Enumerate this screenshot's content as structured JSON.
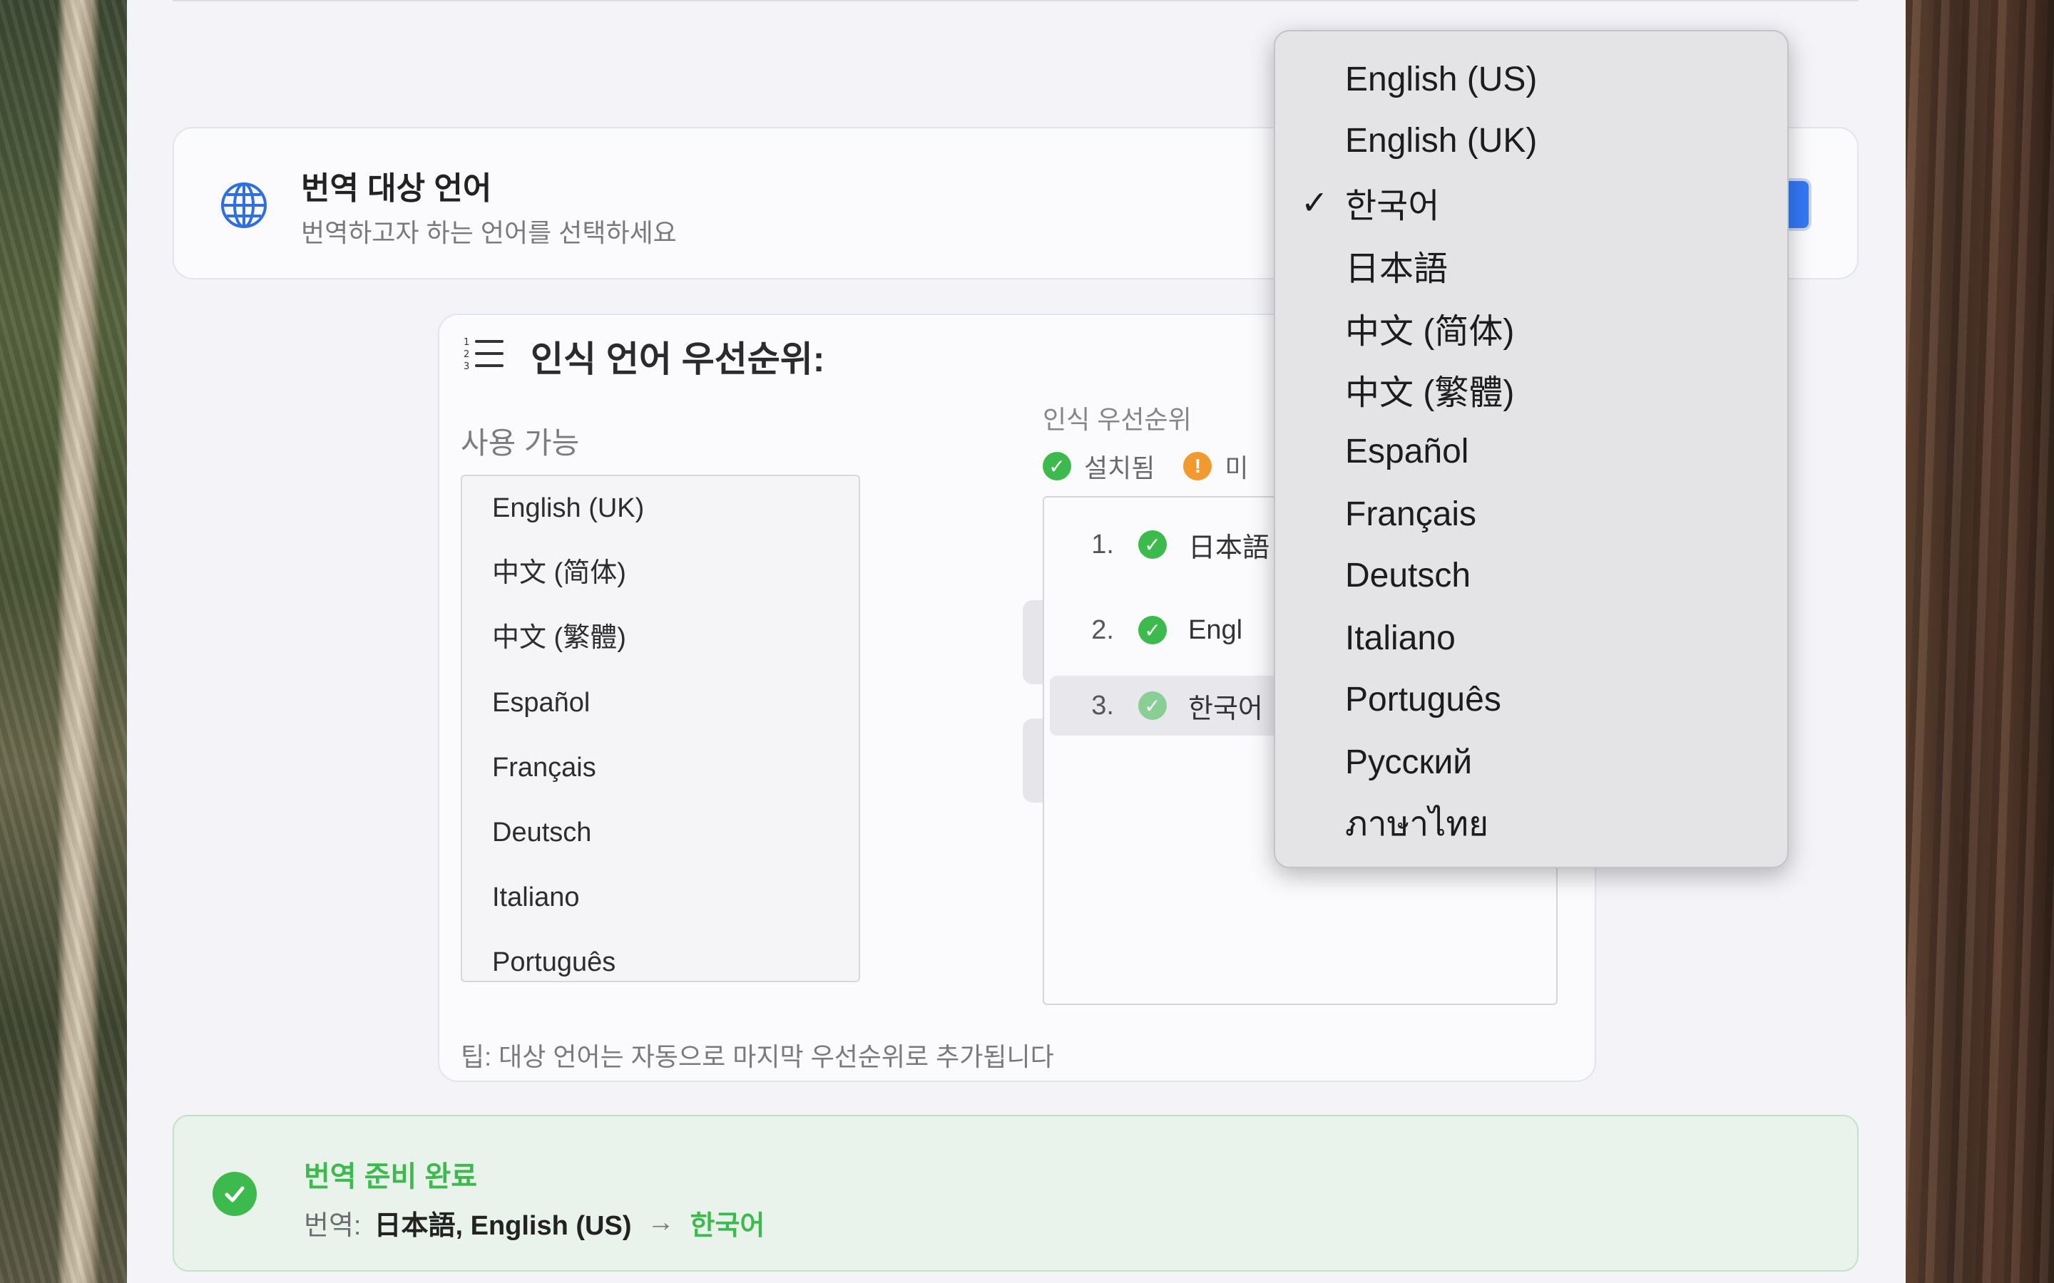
{
  "target_language": {
    "title": "번역 대상 언어",
    "subtitle": "번역하고자 하는 언어를 선택하세요",
    "icon": "globe-icon"
  },
  "priority": {
    "title": "인식 언어 우선순위:",
    "available_label": "사용 가능",
    "available": [
      "English (UK)",
      "中文 (简体)",
      "中文 (繁體)",
      "Español",
      "Français",
      "Deutsch",
      "Italiano",
      "Português"
    ],
    "priority_label": "인식 우선순위",
    "legend_installed": "설치됨",
    "legend_missing": "미",
    "list": [
      {
        "num": "1.",
        "name": "日本語",
        "selected": false
      },
      {
        "num": "2.",
        "name": "Engl",
        "selected": false
      },
      {
        "num": "3.",
        "name": "한국어",
        "selected": true
      }
    ],
    "tip": "팁: 대상 언어는 자동으로 마지막 우선순위로 추가됩니다"
  },
  "ready": {
    "title": "번역 준비 완료",
    "label": "번역:",
    "sources": "日本語, English (US)",
    "arrow": "→",
    "target": "한국어"
  },
  "dropdown": {
    "selected": "한국어",
    "check": "✓",
    "options": [
      "English (US)",
      "English (UK)",
      "한국어",
      "日本語",
      "中文 (简体)",
      "中文 (繁體)",
      "Español",
      "Français",
      "Deutsch",
      "Italiano",
      "Português",
      "Русский",
      "ภาษาไทย"
    ]
  },
  "colors": {
    "accent_blue": "#3478f6",
    "success_green": "#3dba4e",
    "warning_orange": "#f29a2e"
  }
}
